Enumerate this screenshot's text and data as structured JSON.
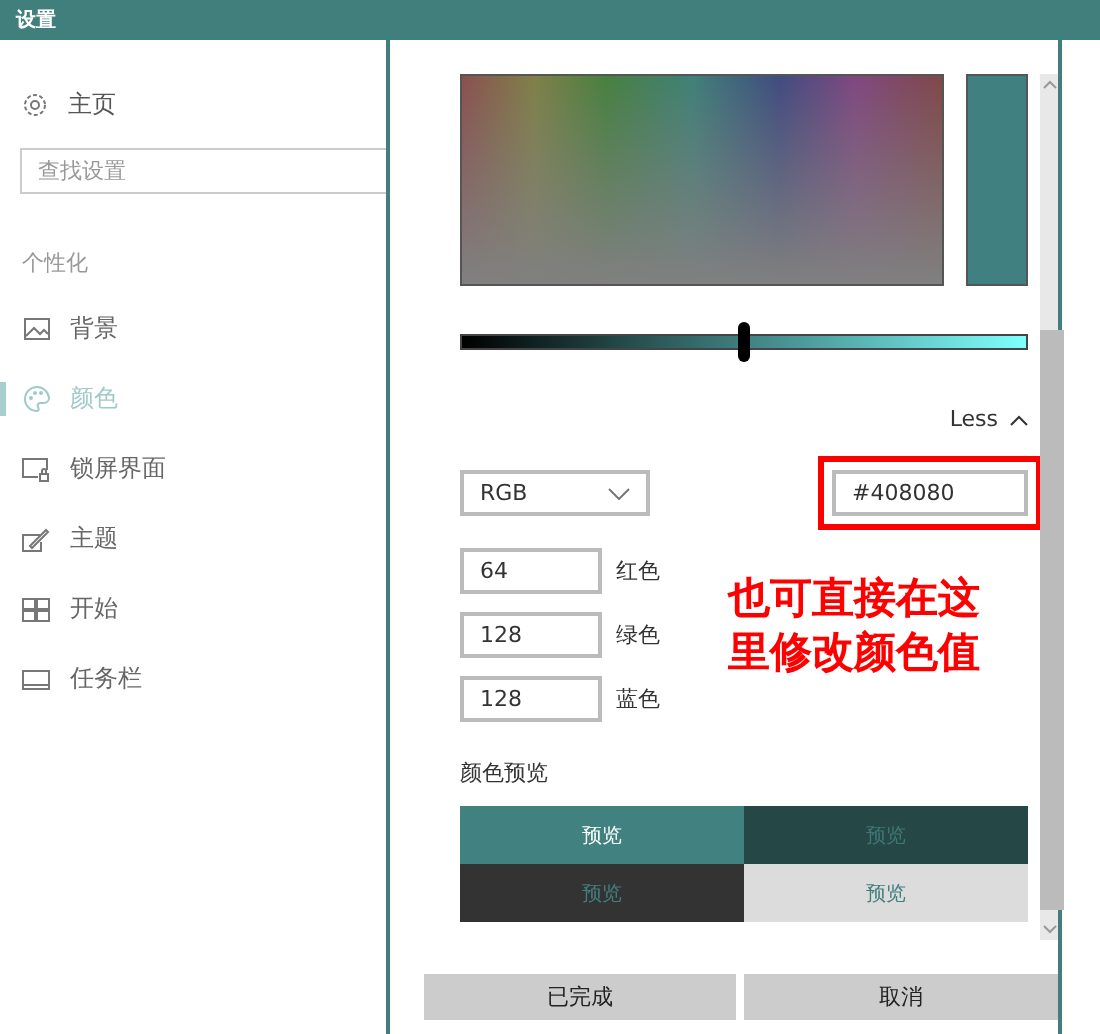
{
  "window": {
    "title": "设置"
  },
  "sidebar": {
    "home": "主页",
    "search": {
      "placeholder": "查找设置"
    },
    "section": "个性化",
    "items": [
      {
        "label": "背景",
        "selected": false
      },
      {
        "label": "颜色",
        "selected": true
      },
      {
        "label": "锁屏界面",
        "selected": false
      },
      {
        "label": "主题",
        "selected": false
      },
      {
        "label": "开始",
        "selected": false
      },
      {
        "label": "任务栏",
        "selected": false
      }
    ]
  },
  "dialog": {
    "slider": {
      "level": 0.5
    },
    "less": "Less",
    "mode": "RGB",
    "hex": "#408080",
    "channels": [
      {
        "value": "64",
        "label": "红色"
      },
      {
        "value": "128",
        "label": "绿色"
      },
      {
        "value": "128",
        "label": "蓝色"
      }
    ],
    "preview_title": "颜色预览",
    "previews": [
      {
        "label": "预览",
        "color": "#418280"
      },
      {
        "label": "预览",
        "color": "#254846"
      },
      {
        "label": "预览",
        "color": "#333333"
      },
      {
        "label": "预览",
        "color": "#dcdcdc"
      }
    ],
    "buttons": [
      "已完成",
      "取消"
    ]
  },
  "annotation": {
    "text": "也可直接在这里修改颜色值"
  }
}
